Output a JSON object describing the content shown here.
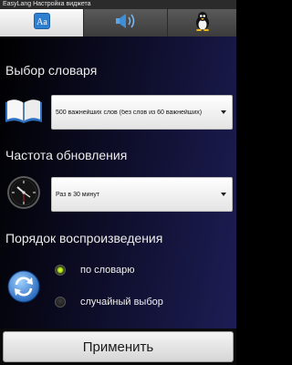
{
  "window": {
    "title": "EasyLang Настройка виджета"
  },
  "tabs": [
    {
      "icon": "dictionary-icon",
      "active": true
    },
    {
      "icon": "speaker-icon",
      "active": false
    },
    {
      "icon": "tux-icon",
      "active": false
    }
  ],
  "dictionary": {
    "title": "Выбор словаря",
    "icon": "open-book-icon",
    "selected": "500 важнейших слов (без слов из 60 важнейших)"
  },
  "frequency": {
    "title": "Частота обновления",
    "icon": "clock-icon",
    "selected": "Раз в 30 минут"
  },
  "playback": {
    "title": "Порядок воспроизведения",
    "icon": "refresh-icon",
    "options": [
      {
        "label": "по словарю",
        "checked": true
      },
      {
        "label": "случайный выбор",
        "checked": false
      }
    ]
  },
  "footer": {
    "apply_label": "Применить"
  },
  "colors": {
    "radio_on": "#b6f000",
    "background_accent": "#1d1d55"
  }
}
